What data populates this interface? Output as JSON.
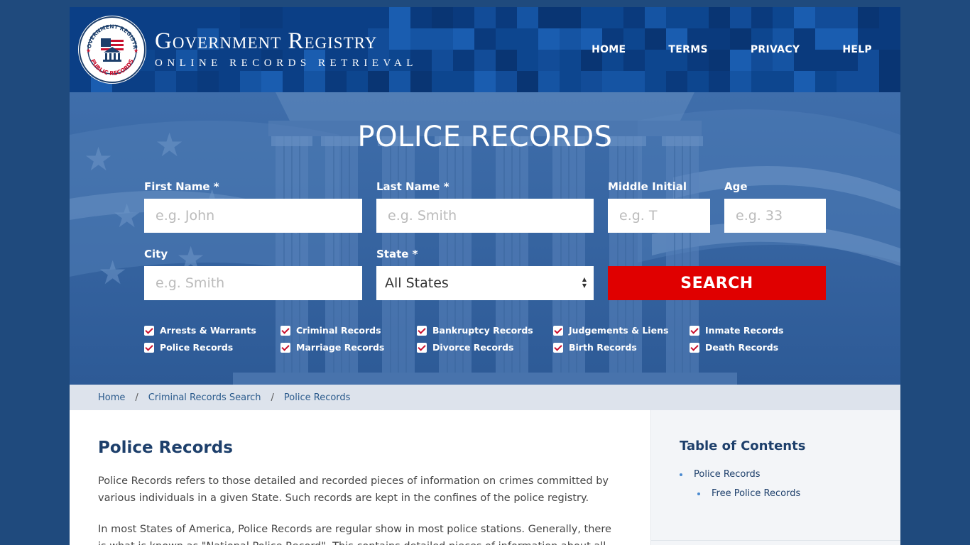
{
  "header": {
    "brand_title": "Government Registry",
    "brand_subtitle": "ONLINE RECORDS RETRIEVAL",
    "seal_text_top": "GOVERNMENT REGISTRY",
    "seal_text_bottom": "PUBLIC RECORDS",
    "nav": [
      "HOME",
      "TERMS",
      "PRIVACY",
      "HELP"
    ]
  },
  "hero": {
    "title": "POLICE RECORDS",
    "fields": {
      "first_name": {
        "label": "First Name *",
        "placeholder": "e.g. John"
      },
      "last_name": {
        "label": "Last Name *",
        "placeholder": "e.g. Smith"
      },
      "middle_initial": {
        "label": "Middle Initial",
        "placeholder": "e.g. T"
      },
      "age": {
        "label": "Age",
        "placeholder": "e.g. 33"
      },
      "city": {
        "label": "City",
        "placeholder": "e.g. Smith"
      },
      "state": {
        "label": "State *",
        "value": "All States"
      }
    },
    "search_label": "SEARCH",
    "checkboxes": [
      "Arrests & Warrants",
      "Criminal Records",
      "Bankruptcy Records",
      "Judgements & Liens",
      "Inmate Records",
      "Police Records",
      "Marriage Records",
      "Divorce Records",
      "Birth Records",
      "Death Records"
    ]
  },
  "breadcrumb": [
    "Home",
    "Criminal Records Search",
    "Police Records"
  ],
  "main": {
    "heading": "Police Records",
    "paragraphs": [
      "Police Records refers to those detailed and recorded pieces of information on crimes committed by various individuals in a given State. Such records are kept in the confines of the police registry.",
      "In most States of America, Police Records are regular show in most police stations. Generally, there is what is known as \"National Police Record\". This contains detailed pieces of information about all the"
    ]
  },
  "toc": {
    "title": "Table of Contents",
    "items": [
      "Police Records",
      "Free Police Records"
    ]
  },
  "colors": {
    "page_bg": "#1f4a7d",
    "header_bg": "#0b3f86",
    "search_button": "#e00000",
    "heading": "#1d3f6b"
  }
}
